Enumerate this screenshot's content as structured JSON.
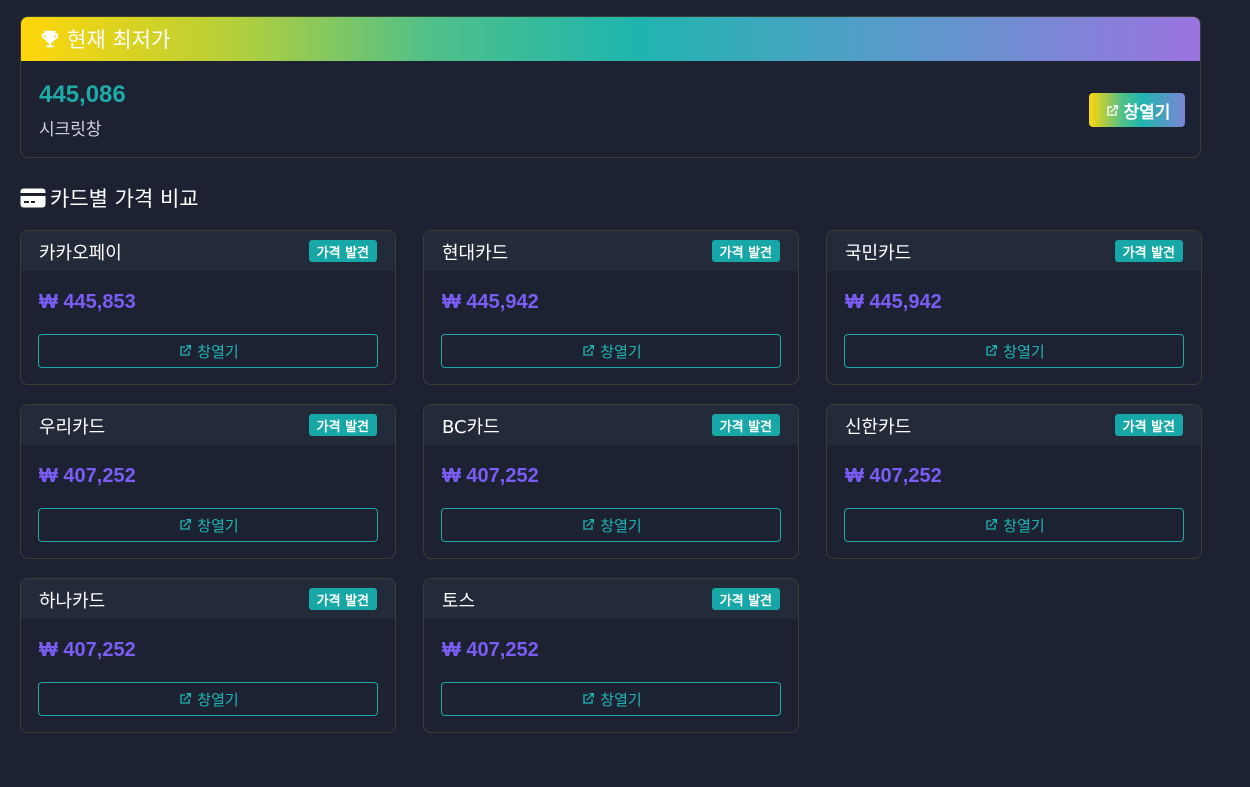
{
  "best": {
    "title": "현재 최저가",
    "price": "445,086",
    "store": "시크릿창",
    "open_label": "창열기",
    "icon": "trophy-icon"
  },
  "section": {
    "title": "카드별 가격 비교",
    "icon": "credit-card-icon"
  },
  "colors": {
    "accent_teal": "#1fa9a9",
    "price_purple": "#7b5cf5",
    "background": "#1c2231"
  },
  "cards": [
    {
      "name": "카카오페이",
      "badge": "가격 발견",
      "price": "₩ 445,853",
      "open_label": "창열기"
    },
    {
      "name": "현대카드",
      "badge": "가격 발견",
      "price": "₩ 445,942",
      "open_label": "창열기"
    },
    {
      "name": "국민카드",
      "badge": "가격 발견",
      "price": "₩ 445,942",
      "open_label": "창열기"
    },
    {
      "name": "우리카드",
      "badge": "가격 발견",
      "price": "₩ 407,252",
      "open_label": "창열기"
    },
    {
      "name": "BC카드",
      "badge": "가격 발견",
      "price": "₩ 407,252",
      "open_label": "창열기"
    },
    {
      "name": "신한카드",
      "badge": "가격 발견",
      "price": "₩ 407,252",
      "open_label": "창열기"
    },
    {
      "name": "하나카드",
      "badge": "가격 발견",
      "price": "₩ 407,252",
      "open_label": "창열기"
    },
    {
      "name": "토스",
      "badge": "가격 발견",
      "price": "₩ 407,252",
      "open_label": "창열기"
    }
  ]
}
